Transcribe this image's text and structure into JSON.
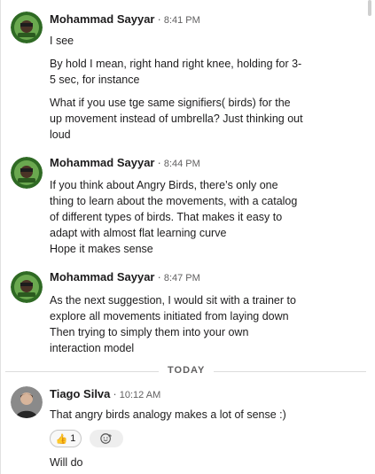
{
  "messages": [
    {
      "author": "Mohammad Sayyar",
      "time": "8:41 PM",
      "lines": [
        "I see",
        "By hold I mean, right hand right knee, holding for 3-",
        "5 sec, for instance",
        "What if you use tge same signifiers( birds) for the",
        "up movement instead of umbrella? Just thinking out",
        "loud"
      ]
    },
    {
      "author": "Mohammad Sayyar",
      "time": "8:44 PM",
      "lines": [
        "If you think about Angry Birds, there’s only one",
        "thing to learn about the movements, with a catalog",
        "of different types of birds. That makes it easy to",
        "adapt with almost flat learning curve",
        "Hope it makes sense"
      ]
    },
    {
      "author": "Mohammad Sayyar",
      "time": "8:47 PM",
      "lines": [
        "As the next suggestion, I would sit with a trainer to",
        "explore all movements initiated from laying down",
        "Then trying to simply them into your own",
        "interaction model"
      ]
    }
  ],
  "divider": {
    "label": "TODAY"
  },
  "reply": {
    "author": "Tiago Silva",
    "time": "10:12 AM",
    "lines": [
      "That angry birds analogy makes a lot of sense :)",
      "Will do"
    ],
    "reaction": {
      "emoji": "👍",
      "count": "1"
    }
  },
  "separator": "·",
  "icons": {
    "reaction_emoji": "thumbs-up-icon",
    "add_reaction": "add-reaction-icon",
    "avatar_mohammad": "green-badge-avatar",
    "avatar_tiago": "photo-avatar"
  },
  "colors": {
    "name": "#1d1c1d",
    "meta": "#616061",
    "avatar_ring": "#4a8a2d"
  }
}
